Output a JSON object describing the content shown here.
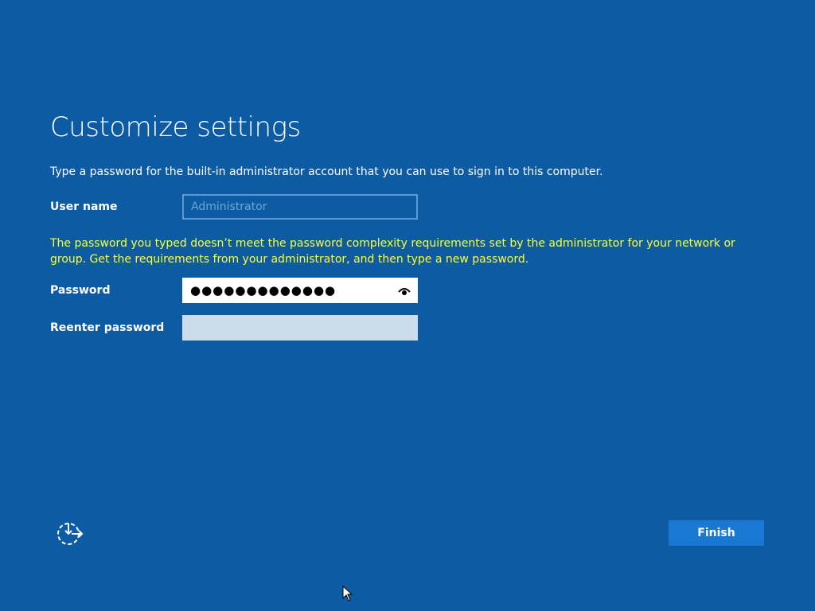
{
  "page": {
    "title": "Customize settings",
    "description": "Type a password for the built-in administrator account that you can use to sign in to this computer."
  },
  "form": {
    "username_label": "User name",
    "username_placeholder": "Administrator",
    "warning": "The password you typed doesn’t meet the password complexity requirements set by the administrator for your network or group. Get the requirements from your administrator, and then type a new password.",
    "password_label": "Password",
    "password_masked": "●●●●●●●●●●●●●",
    "reenter_label": "Reenter password",
    "reenter_value": ""
  },
  "footer": {
    "accessibility_icon": "ease-of-access-icon",
    "finish_label": "Finish"
  },
  "colors": {
    "background": "#0d5ba3",
    "warning_text": "#ffff33",
    "button": "#1979d2"
  }
}
